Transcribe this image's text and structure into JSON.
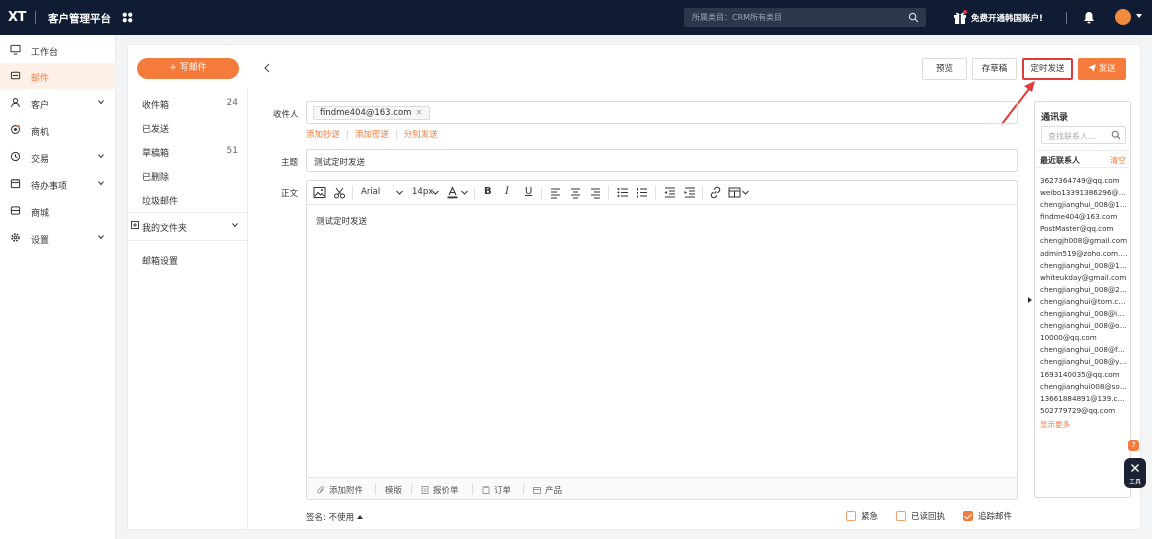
{
  "header": {
    "logo": "XT",
    "title": "客户管理平台",
    "search_placeholder": "所属类目：CRM所有类目",
    "promo": "免费开通韩国账户!"
  },
  "nav": {
    "items": [
      {
        "label": "工作台",
        "icon": "monitor-icon"
      },
      {
        "label": "邮件",
        "icon": "mail-icon",
        "active": true
      },
      {
        "label": "客户",
        "icon": "user-icon",
        "expandable": true
      },
      {
        "label": "商机",
        "icon": "opportunity-icon"
      },
      {
        "label": "交易",
        "icon": "trade-icon",
        "expandable": true
      },
      {
        "label": "待办事项",
        "icon": "calendar-icon",
        "expandable": true
      },
      {
        "label": "商城",
        "icon": "store-icon"
      },
      {
        "label": "设置",
        "icon": "gear-icon",
        "expandable": true
      }
    ]
  },
  "mailbox": {
    "compose": "+ 写邮件",
    "folders": [
      {
        "label": "收件箱",
        "count": "24"
      },
      {
        "label": "已发送",
        "count": ""
      },
      {
        "label": "草稿箱",
        "count": "51"
      },
      {
        "label": "已删除",
        "count": ""
      },
      {
        "label": "垃圾邮件",
        "count": ""
      }
    ],
    "my_folders": "我的文件夹",
    "settings": "邮箱设置"
  },
  "actions": {
    "preview": "预览",
    "save_draft": "存草稿",
    "schedule": "定时发送",
    "send": "发送"
  },
  "form": {
    "to_label": "收件人",
    "recipient": "findme404@163.com",
    "cc": "添加抄送",
    "bcc": "添加密送",
    "separate": "分别发送",
    "subject_label": "主题",
    "subject": "测试定时发送",
    "body_label": "正文",
    "font": "Arial",
    "font_size": "14px",
    "body": "测试定时发送"
  },
  "attach": {
    "add_attachment": "添加附件",
    "template": "模版",
    "quote": "报价单",
    "order": "订单",
    "product": "产品"
  },
  "footer": {
    "signature_label": "签名:",
    "signature_value": "不使用",
    "urgent": "紧急",
    "read_receipt": "已读回执",
    "track": "追踪邮件",
    "urgent_checked": false,
    "read_receipt_checked": false,
    "track_checked": true
  },
  "contacts": {
    "title": "通讯录",
    "search_placeholder": "查找联系人...",
    "recent": "最近联系人",
    "clear": "清空",
    "list": [
      "3627364749@qq.com",
      "weibo13391386296@sin...",
      "chengjianghui_008@126...",
      "findme404@163.com",
      "PostMaster@qq.com",
      "chengjh008@gmail.com",
      "admin519@zoho.com.cn",
      "chengjianghui_008@163....",
      "whiteukday@gmail.com",
      "chengjianghui_008@21c...",
      "chengjianghui@tom.com",
      "chengjianghui_008@iclou...",
      "chengjianghui_008@outl...",
      "10000@qq.com",
      "chengjianghui_008@fox...",
      "chengjianghui_008@yea...",
      "1693140035@qq.com",
      "chengjianghui008@sohu...",
      "13661884891@139.com",
      "502779729@qq.com"
    ],
    "more": "显示更多"
  },
  "widget": {
    "badge": "7",
    "tool_label": "工具"
  },
  "colors": {
    "accent": "#f47b3c",
    "topbar": "#0f1c33",
    "highlight": "#e03a3a"
  }
}
